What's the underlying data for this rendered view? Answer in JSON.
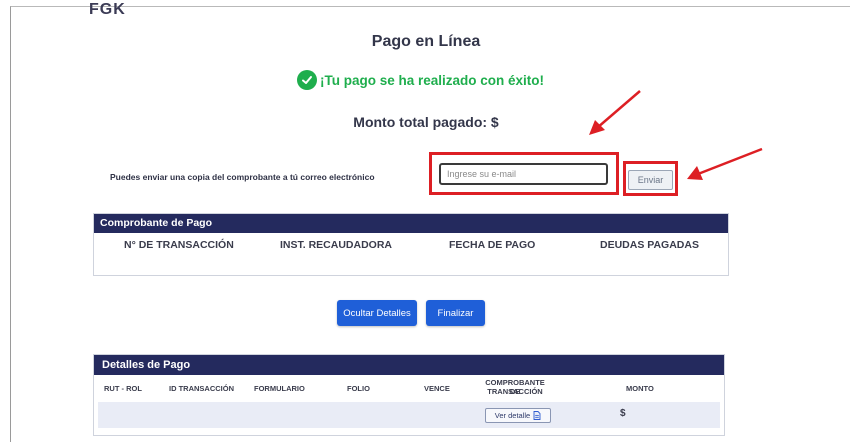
{
  "header": {
    "logo_fragment": "FGK"
  },
  "page_title": "Pago en Línea",
  "success_message": "¡Tu pago se ha realizado con éxito!",
  "total_paid": "Monto total pagado: $",
  "email_section": {
    "label": "Puedes enviar una copia del comprobante a tú correo electrónico",
    "input_placeholder": "Ingrese su e-mail",
    "input_value": "",
    "send_label": "Enviar"
  },
  "receipt": {
    "title": "Comprobante de Pago",
    "columns": [
      "N° DE TRANSACCIÓN",
      "INST. RECAUDADORA",
      "FECHA DE PAGO",
      "DEUDAS PAGADAS"
    ]
  },
  "actions": {
    "hide_details": "Ocultar Detalles",
    "finish": "Finalizar"
  },
  "details": {
    "title": "Detalles de Pago",
    "columns": [
      "RUT - ROL",
      "ID TRANSACCIÓN",
      "FORMULARIO",
      "FOLIO",
      "VENCE",
      "COMPROBANTE DE",
      "TRANSACCIÓN",
      "MONTO"
    ],
    "row": {
      "view_label": "Ver detalle",
      "amount": "$"
    }
  },
  "colors": {
    "accent": "#1f5fd8",
    "header_bg": "#242a5e",
    "success": "#1fae4d",
    "annotation": "#dd1f24"
  },
  "icons": [
    "check-circle-icon",
    "document-icon",
    "arrow-annotation-icon"
  ]
}
